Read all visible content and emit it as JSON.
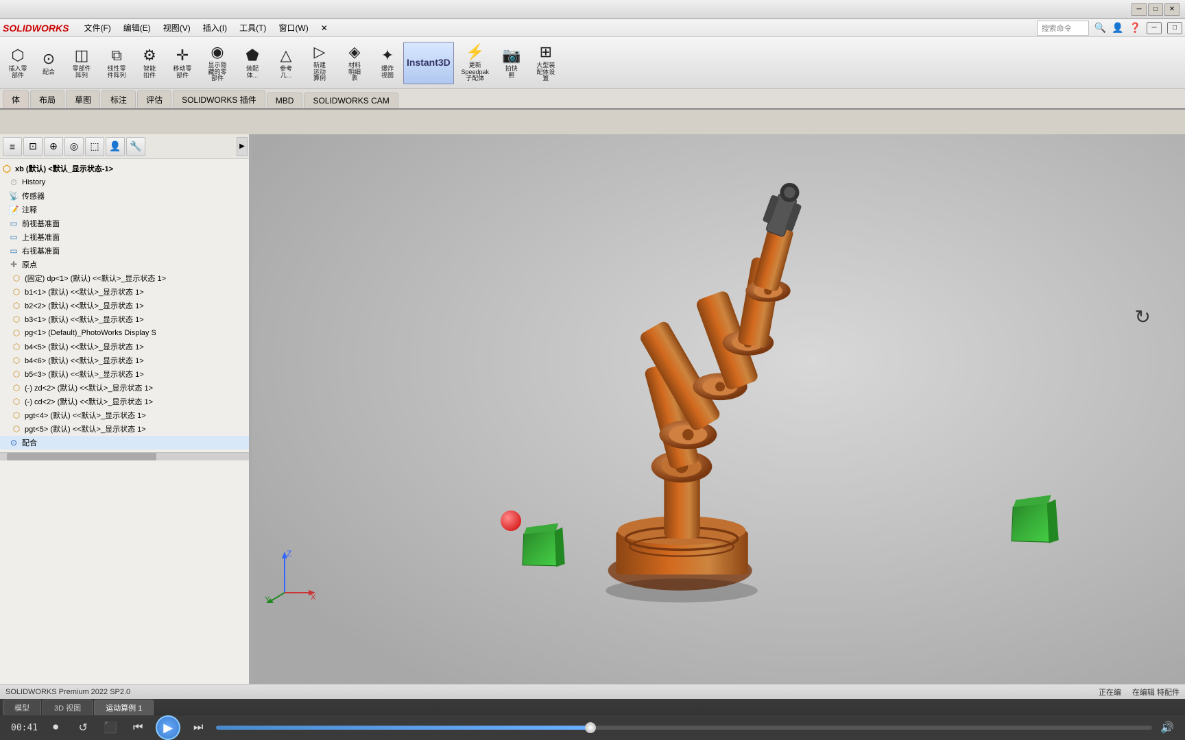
{
  "app": {
    "name": "SOLIDWORKS",
    "title": "SOLIDWORKS Premium 2022 SP2.0",
    "edition": "Premium"
  },
  "titlebar": {
    "minimize": "─",
    "maximize": "□",
    "close": "✕",
    "win_buttons": [
      "─",
      "□",
      "✕"
    ]
  },
  "menubar": {
    "logo": "SOLIDWORKS",
    "items": [
      "文件(F)",
      "编辑(E)",
      "视图(V)",
      "插入(I)",
      "工具(T)",
      "窗口(W)",
      "✕"
    ]
  },
  "toolbar": {
    "buttons": [
      {
        "id": "insert-part",
        "icon": "⬡",
        "label": "插入零\n部件"
      },
      {
        "id": "mate",
        "icon": "⊙",
        "label": "配合"
      },
      {
        "id": "sub-assembly",
        "icon": "◫",
        "label": "零部件\n阵列"
      },
      {
        "id": "linear-component",
        "icon": "⧉",
        "label": "线性零\n件阵列"
      },
      {
        "id": "smart-fastener",
        "icon": "⚙",
        "label": "智能\n扣件"
      },
      {
        "id": "move-component",
        "icon": "✛",
        "label": "移动零\n部件"
      },
      {
        "id": "show-hide",
        "icon": "◉",
        "label": "显示隐\n藏的零\n部件"
      },
      {
        "id": "assembly-features",
        "icon": "⬟",
        "label": "装配\n体..."
      },
      {
        "id": "reference-geometry",
        "icon": "△",
        "label": "参考\n几..."
      },
      {
        "id": "new-motion",
        "icon": "▷",
        "label": "新建\n运动\n算例"
      },
      {
        "id": "clearance",
        "icon": "◈",
        "label": "材料\n明细\n表"
      },
      {
        "id": "explode",
        "icon": "✦",
        "label": "爆炸\n视图"
      },
      {
        "id": "instant3d",
        "icon": "3D",
        "label": "Instant3D"
      },
      {
        "id": "speedpak",
        "icon": "⚡",
        "label": "更新\nSpeedpak\n子配体"
      },
      {
        "id": "capture",
        "icon": "📷",
        "label": "拍快\n照"
      },
      {
        "id": "large-assembly",
        "icon": "⊞",
        "label": "大型装\n配体设\n置"
      }
    ]
  },
  "tabbar": {
    "tabs": [
      "体",
      "布局",
      "草图",
      "标注",
      "评估",
      "SOLIDWORKS 插件",
      "MBD",
      "SOLIDWORKS CAM"
    ]
  },
  "viewport_toolbar": {
    "buttons": [
      "🔍",
      "🔎",
      "✏",
      "⬛",
      "✂",
      "▣",
      "☼",
      "●",
      "⚙",
      "⊙",
      "🔲",
      "▪"
    ]
  },
  "tree": {
    "root": "xb (默认) <默认_显示状态-1>",
    "items": [
      {
        "id": "history",
        "icon": "⏱",
        "label": "History",
        "indent": 0
      },
      {
        "id": "sensors",
        "icon": "📡",
        "label": "传感器",
        "indent": 0
      },
      {
        "id": "annotations",
        "icon": "📝",
        "label": "注释",
        "indent": 0
      },
      {
        "id": "front-plane",
        "icon": "▭",
        "label": "前视基准面",
        "indent": 0
      },
      {
        "id": "top-plane",
        "icon": "▭",
        "label": "上视基准面",
        "indent": 0
      },
      {
        "id": "right-plane",
        "icon": "▭",
        "label": "右视基准面",
        "indent": 0
      },
      {
        "id": "origin",
        "icon": "✚",
        "label": "原点",
        "indent": 0
      },
      {
        "id": "dp1",
        "icon": "⬡",
        "label": "(固定) dp<1> (默认) <<默认>_显示状态 1>",
        "indent": 1
      },
      {
        "id": "b1-1",
        "icon": "⬡",
        "label": "b1<1> (默认) <<默认>_显示状态 1>",
        "indent": 1
      },
      {
        "id": "b2-2",
        "icon": "⬡",
        "label": "b2<2> (默认) <<默认>_显示状态 1>",
        "indent": 1
      },
      {
        "id": "b3-1",
        "icon": "⬡",
        "label": "b3<1> (默认) <<默认>_显示状态 1>",
        "indent": 1
      },
      {
        "id": "pg1",
        "icon": "⬡",
        "label": "pg<1> (Default)_PhotoWorks Display S",
        "indent": 1
      },
      {
        "id": "b4-5",
        "icon": "⬡",
        "label": "b4<5> (默认) <<默认>_显示状态 1>",
        "indent": 1
      },
      {
        "id": "b4-6",
        "icon": "⬡",
        "label": "b4<6> (默认) <<默认>_显示状态 1>",
        "indent": 1
      },
      {
        "id": "b5-3",
        "icon": "⬡",
        "label": "b5<3> (默认) <<默认>_显示状态 1>",
        "indent": 1
      },
      {
        "id": "zd2",
        "icon": "⬡",
        "label": "(-) zd<2> (默认) <<默认>_显示状态 1>",
        "indent": 1
      },
      {
        "id": "cd2",
        "icon": "⬡",
        "label": "(-) cd<2> (默认) <<默认>_显示状态 1>",
        "indent": 1
      },
      {
        "id": "pgt4",
        "icon": "⬡",
        "label": "pgt<4> (默认) <<默认>_显示状态 1>",
        "indent": 1
      },
      {
        "id": "pgt5",
        "icon": "⬡",
        "label": "pgt<5> (默认) <<默认>_显示状态 1>",
        "indent": 1
      },
      {
        "id": "assembly",
        "icon": "⬡",
        "label": "配合",
        "indent": 0
      }
    ]
  },
  "secondary_toolbar": {
    "buttons": [
      "≡",
      "⊡",
      "⊕",
      "◎",
      "⬚",
      "👤",
      "🔧"
    ]
  },
  "animation": {
    "tabs": [
      "模型",
      "3D 视图",
      "运动算例 1"
    ],
    "time": "00:41",
    "controls": {
      "record": "⏺",
      "reset": "↺",
      "stop": "⬛",
      "prev": "⏮",
      "play": "▶",
      "next": "⏭",
      "volume": "🔊"
    },
    "progress": 40
  },
  "statusbar": {
    "left": "SOLIDWORKS Premium 2022 SP2.0",
    "right_items": [
      "正在编",
      "在编辑 特配件"
    ]
  },
  "viewport": {
    "bg_color_start": "#e0e0e0",
    "bg_color_end": "#b8b8b8"
  }
}
